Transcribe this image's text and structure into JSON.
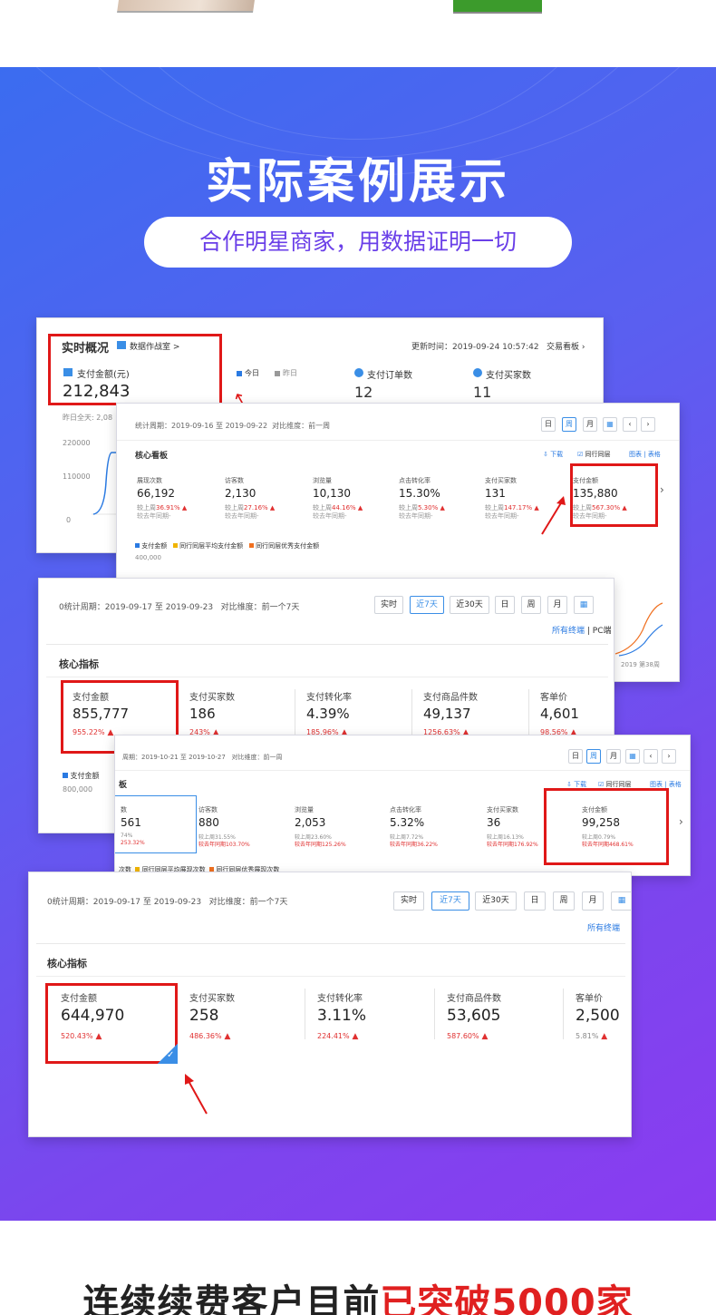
{
  "header": {
    "title": "实际案例展示",
    "subtitle": "合作明星商家，用数据证明一切"
  },
  "card1": {
    "title": "实时概况",
    "link": "数据作战室 >",
    "update_time": "更新时间：2019-09-24 10:57:42",
    "board_link": "交易看板",
    "pay_amount_label": "支付金额(元)",
    "pay_amount": "212,843",
    "legend_today": "今日",
    "legend_yesterday": "昨日",
    "orders_label": "支付订单数",
    "orders_value": "12",
    "buyers_label": "支付买家数",
    "buyers_value": "11",
    "yesterday_full": "昨日全天: 2,08",
    "y_ticks": [
      "220000",
      "110000",
      "0"
    ]
  },
  "card2": {
    "period": "统计周期：2019-09-16 至 2019-09-22",
    "compare": "对比维度：前一周",
    "buttons": [
      "日",
      "周",
      "月"
    ],
    "section_title": "核心看板",
    "download": "下载",
    "peer_check": "同行同层",
    "chart_link": "图表",
    "table_link": "表格",
    "metrics": [
      {
        "label": "展现次数",
        "value": "66,192",
        "sub1": "较上周",
        "pct": "36.91%",
        "sub2": "较去年同期-"
      },
      {
        "label": "访客数",
        "value": "2,130",
        "sub1": "较上周",
        "pct": "27.16%",
        "sub2": "较去年同期-"
      },
      {
        "label": "浏览量",
        "value": "10,130",
        "sub1": "较上周",
        "pct": "44.16%",
        "sub2": "较去年同期-"
      },
      {
        "label": "点击转化率",
        "value": "15.30%",
        "sub1": "较上周",
        "pct": "5.30%",
        "sub2": "较去年同期-"
      },
      {
        "label": "支付买家数",
        "value": "131",
        "sub1": "较上周",
        "pct": "147.17%",
        "sub2": "较去年同期-"
      },
      {
        "label": "支付金额",
        "value": "135,880",
        "sub1": "较上周",
        "pct": "567.30%",
        "sub2": "较去年同期-"
      }
    ],
    "legend": [
      "支付金额",
      "同行同层平均支付金额",
      "同行同层优秀支付金额"
    ],
    "y_tick": "400,000",
    "week_label": "2019 第38周"
  },
  "card3": {
    "period": "0统计周期：2019-09-17 至 2019-09-23",
    "compare": "对比维度：前一个7天",
    "buttons": [
      "实时",
      "近7天",
      "近30天",
      "日",
      "周",
      "月"
    ],
    "terminal_link": "所有终端",
    "terminal_pc": "PC端",
    "section_title": "核心指标",
    "metrics": [
      {
        "label": "支付金额",
        "value": "855,777",
        "pct": "955.22%"
      },
      {
        "label": "支付买家数",
        "value": "186",
        "pct": "243%"
      },
      {
        "label": "支付转化率",
        "value": "4.39%",
        "pct": "185.96%"
      },
      {
        "label": "支付商品件数",
        "value": "49,137",
        "pct": "1256.63%"
      },
      {
        "label": "客单价",
        "value": "4,601",
        "pct": "98.56%"
      }
    ],
    "legend_pay": "支付金额",
    "y_tick": "800,000"
  },
  "card4": {
    "period": "周期：2019-10-21 至 2019-10-27",
    "compare": "对比维度：前一周",
    "buttons": [
      "日",
      "周",
      "月"
    ],
    "section_title": "板",
    "download": "下载",
    "peer_check": "同行同层",
    "chart_link": "图表",
    "table_link": "表格",
    "metrics": [
      {
        "label": "数",
        "value": "561",
        "sub1": "74%",
        "sub2": "253.32%"
      },
      {
        "label": "访客数",
        "value": "880",
        "sub1": "较上周31.55%",
        "sub2": "较去年同期103.70%"
      },
      {
        "label": "浏览量",
        "value": "2,053",
        "sub1": "较上周23.60%",
        "sub2": "较去年同期125.26%"
      },
      {
        "label": "点击转化率",
        "value": "5.32%",
        "sub1": "较上周7.72%",
        "sub2": "较去年同期36.22%"
      },
      {
        "label": "支付买家数",
        "value": "36",
        "sub1": "较上周16.13%",
        "sub2": "较去年同期176.92%"
      },
      {
        "label": "支付金额",
        "value": "99,258",
        "sub1": "较上周0.79%",
        "sub2": "较去年同期468.61%"
      }
    ],
    "legend": [
      "次数",
      "同行同层平均展现次数",
      "同行同层优秀展现次数"
    ]
  },
  "card5": {
    "period": "0统计周期：2019-09-17 至 2019-09-23",
    "compare": "对比维度：前一个7天",
    "buttons": [
      "实时",
      "近7天",
      "近30天",
      "日",
      "周",
      "月"
    ],
    "terminal_link": "所有终端",
    "section_title": "核心指标",
    "metrics": [
      {
        "label": "支付金额",
        "value": "644,970",
        "pct": "520.43%"
      },
      {
        "label": "支付买家数",
        "value": "258",
        "pct": "486.36%"
      },
      {
        "label": "支付转化率",
        "value": "3.11%",
        "pct": "224.41%"
      },
      {
        "label": "支付商品件数",
        "value": "53,605",
        "pct": "587.60%"
      },
      {
        "label": "客单价",
        "value": "2,500",
        "pct": "5.81%"
      }
    ]
  },
  "footer": {
    "text_prefix": "连续续费客户目前",
    "text_highlight": "已突破5000家"
  },
  "colors": {
    "accent_red": "#e01818",
    "banner_start": "#3b6cf0",
    "banner_end": "#8a3cf0",
    "subtitle_purple": "#6a3fe8",
    "link_blue": "#2a7ae2"
  }
}
